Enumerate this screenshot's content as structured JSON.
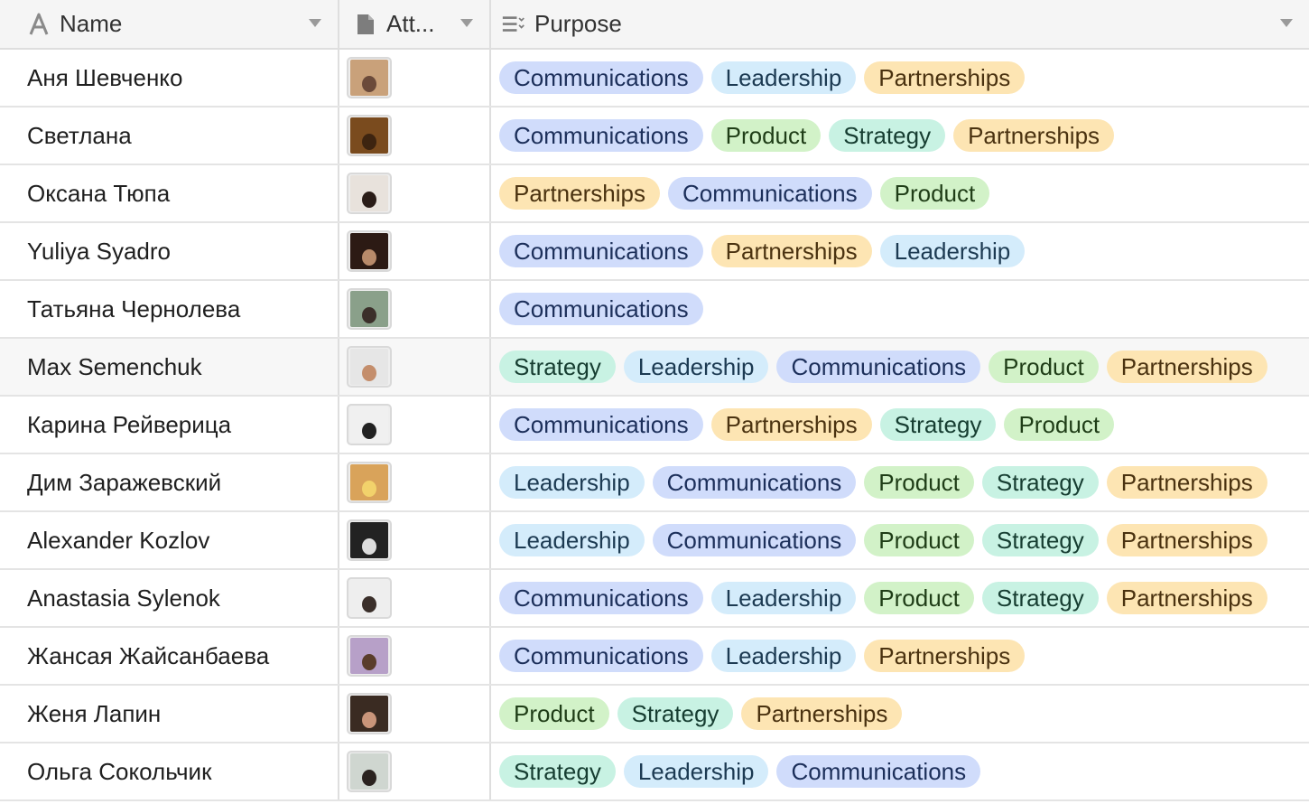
{
  "header": {
    "name_label": "Name",
    "attachment_label": "Att...",
    "purpose_label": "Purpose"
  },
  "icons": {
    "name_field": "text-field-icon",
    "attachment_field": "file-icon",
    "purpose_field": "multiselect-icon",
    "dropdown": "chevron-down-icon"
  },
  "colors": {
    "Communications": "#d0dcfb",
    "Leadership": "#d4ecfb",
    "Partnerships": "#fde5b3",
    "Product": "#d2f2c8",
    "Strategy": "#c8f2e3"
  },
  "rows": [
    {
      "name": "Аня Шевченко",
      "purpose": [
        "Communications",
        "Leadership",
        "Partnerships"
      ]
    },
    {
      "name": "Светлана",
      "purpose": [
        "Communications",
        "Product",
        "Strategy",
        "Partnerships"
      ]
    },
    {
      "name": "Оксана Тюпа",
      "purpose": [
        "Partnerships",
        "Communications",
        "Product"
      ]
    },
    {
      "name": "Yuliya Syadro",
      "purpose": [
        "Communications",
        "Partnerships",
        "Leadership"
      ]
    },
    {
      "name": "Татьяна Чернолева",
      "purpose": [
        "Communications"
      ]
    },
    {
      "name": "Max Semenchuk",
      "purpose": [
        "Strategy",
        "Leadership",
        "Communications",
        "Product",
        "Partnerships"
      ]
    },
    {
      "name": "Карина Рейверица",
      "purpose": [
        "Communications",
        "Partnerships",
        "Strategy",
        "Product"
      ]
    },
    {
      "name": "Дим Заражевский",
      "purpose": [
        "Leadership",
        "Communications",
        "Product",
        "Strategy",
        "Partnerships"
      ]
    },
    {
      "name": "Alexander Kozlov",
      "purpose": [
        "Leadership",
        "Communications",
        "Product",
        "Strategy",
        "Partnerships"
      ]
    },
    {
      "name": "Anastasia Sylenok",
      "purpose": [
        "Communications",
        "Leadership",
        "Product",
        "Strategy",
        "Partnerships"
      ]
    },
    {
      "name": "Жансая Жайсанбаева",
      "purpose": [
        "Communications",
        "Leadership",
        "Partnerships"
      ]
    },
    {
      "name": "Женя Лапин",
      "purpose": [
        "Product",
        "Strategy",
        "Partnerships"
      ]
    },
    {
      "name": "Ольга Сокольчик",
      "purpose": [
        "Strategy",
        "Leadership",
        "Communications"
      ]
    }
  ]
}
